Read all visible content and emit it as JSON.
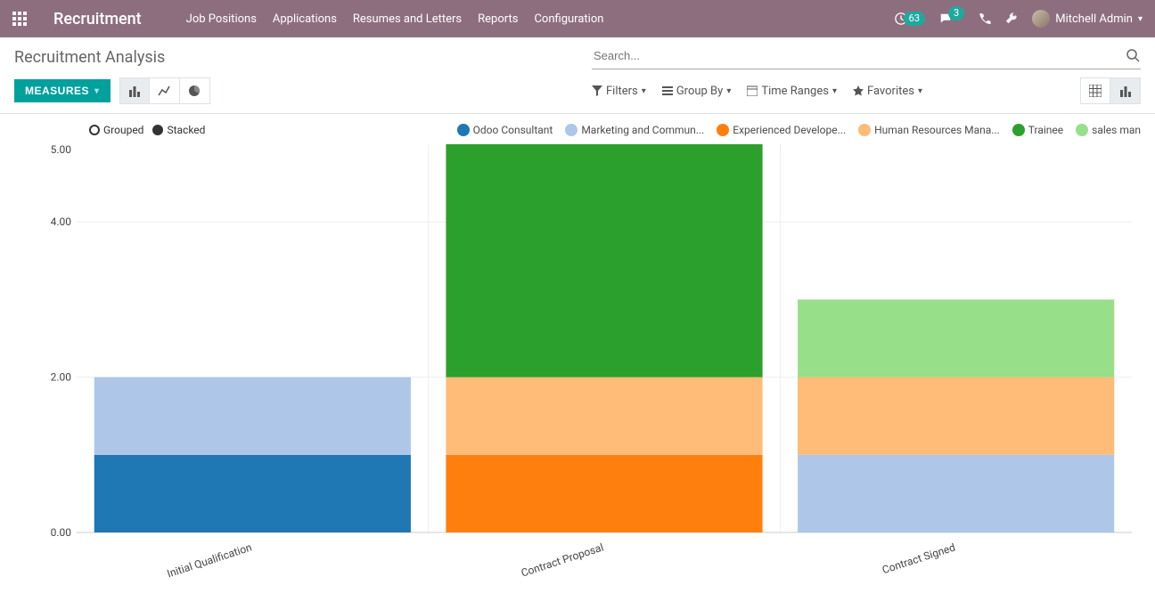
{
  "app_title": "Recruitment",
  "nav": {
    "items": [
      "Job Positions",
      "Applications",
      "Resumes and Letters",
      "Reports",
      "Configuration"
    ]
  },
  "status": {
    "activity_count": "63",
    "msg_count": "3"
  },
  "user": {
    "name": "Mitchell Admin"
  },
  "breadcrumb": "Recruitment Analysis",
  "search": {
    "placeholder": "Search..."
  },
  "measures_label": "MEASURES",
  "filters": {
    "filters": "Filters",
    "groupby": "Group By",
    "timeranges": "Time Ranges",
    "favorites": "Favorites"
  },
  "modes": {
    "grouped": "Grouped",
    "stacked": "Stacked",
    "selected": "stacked"
  },
  "chart_data": {
    "type": "bar",
    "stacked": true,
    "ylabel": "",
    "ylim": [
      0,
      5
    ],
    "yticks": [
      0.0,
      2.0,
      4.0,
      5.0
    ],
    "categories": [
      "Initial Qualification",
      "Contract Proposal",
      "Contract Signed"
    ],
    "series": [
      {
        "name": "Odoo Consultant",
        "color": "#1f77b4",
        "values": [
          1,
          0,
          0
        ]
      },
      {
        "name": "Marketing and Commun...",
        "color": "#aec7e8",
        "values": [
          1,
          0,
          1
        ]
      },
      {
        "name": "Experienced Develope...",
        "color": "#ff7f0e",
        "values": [
          0,
          1,
          0
        ]
      },
      {
        "name": "Human Resources Mana...",
        "color": "#ffbb78",
        "values": [
          0,
          1,
          1
        ]
      },
      {
        "name": "Trainee",
        "color": "#2ca02c",
        "values": [
          0,
          3,
          0
        ]
      },
      {
        "name": "sales man",
        "color": "#98df8a",
        "values": [
          0,
          0,
          1
        ]
      }
    ]
  }
}
